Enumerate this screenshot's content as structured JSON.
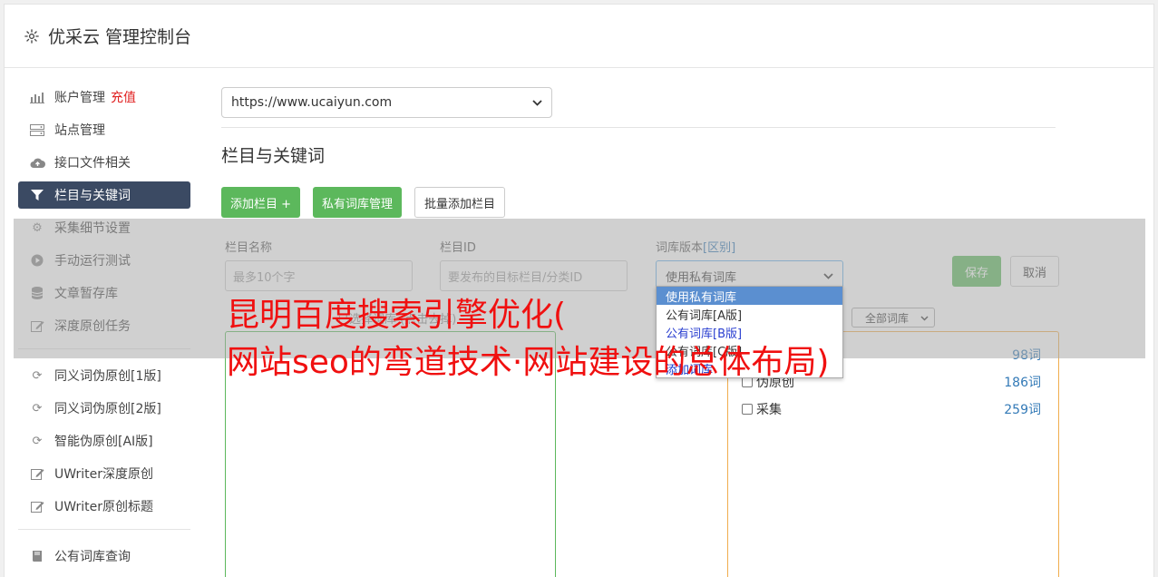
{
  "header": {
    "title": "优采云 管理控制台",
    "icon": "gear-icon"
  },
  "sidebar": {
    "items": [
      {
        "label": "账户管理",
        "badge": "充值",
        "icon": "bar-chart-icon"
      },
      {
        "label": "站点管理",
        "icon": "server-icon"
      },
      {
        "label": "接口文件相关",
        "icon": "cloud-upload-icon"
      },
      {
        "label": "栏目与关键词",
        "icon": "filter-icon",
        "active": true
      },
      {
        "label": "采集细节设置",
        "icon": "cogs-icon"
      },
      {
        "label": "手动运行测试",
        "icon": "play-icon"
      },
      {
        "label": "文章暂存库",
        "icon": "database-icon"
      },
      {
        "label": "深度原创任务",
        "icon": "edit-icon"
      }
    ],
    "items2": [
      {
        "label": "同义词伪原创[1版]",
        "icon": "refresh-icon"
      },
      {
        "label": "同义词伪原创[2版]",
        "icon": "refresh-icon"
      },
      {
        "label": "智能伪原创[AI版]",
        "icon": "refresh-icon"
      },
      {
        "label": "UWriter深度原创",
        "icon": "edit-icon"
      },
      {
        "label": "UWriter原创标题",
        "icon": "edit-icon"
      }
    ],
    "items3": [
      {
        "label": "公有词库查询",
        "icon": "book-icon"
      }
    ]
  },
  "main": {
    "site_select": "https://www.ucaiyun.com",
    "section_title": "栏目与关键词",
    "buttons": {
      "add_column": "添加栏目 +",
      "private_lib": "私有词库管理",
      "batch_add": "批量添加栏目"
    },
    "form": {
      "name_label": "栏目名称",
      "name_placeholder": "最多10个字",
      "id_label": "栏目ID",
      "id_placeholder": "要发布的目标栏目/分类ID",
      "lib_label": "词库版本",
      "lib_link": "[区别]",
      "lib_value": "使用私有词库",
      "save": "保存",
      "cancel": "取消"
    },
    "dropdown_options": [
      "使用私有词库",
      "公有词库[A版]",
      "公有词库[B版]",
      "公有词库[C版]",
      "添加词库"
    ],
    "left_panel_head": "已选择词库 (点击去掉)",
    "lib_filter": "全部词库",
    "libraries": [
      {
        "name": "",
        "count": "98词"
      },
      {
        "name": "伪原创",
        "count": "186词"
      },
      {
        "name": "采集",
        "count": "259词"
      }
    ]
  },
  "headline": {
    "line1": "昆明百度搜索引擎优化(",
    "line2": "网站seo的弯道技术·网站建设的总体布局)"
  },
  "colors": {
    "active_nav": "#3b4a63",
    "green": "#5cb85c",
    "red_text": "#f01010",
    "orange_border": "#f0ad4e"
  }
}
